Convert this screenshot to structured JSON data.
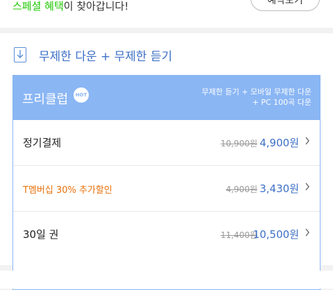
{
  "top": {
    "highlight": "스페셜 혜택",
    "message": "이 찾아갑니다!",
    "reserve_button": "예약보기"
  },
  "section": {
    "title": "무제한 다운 + 무제한 듣기"
  },
  "plan": {
    "name": "프리클럽",
    "badge": "HOT",
    "desc_line1": "무제한 듣기 + 모바일 무제한 다운",
    "desc_line2": "+ PC 100곡 다운",
    "options": [
      {
        "label": "정기결제",
        "original_price": "10,900원",
        "price": "4,900원"
      },
      {
        "label": "T멤버십 30% 추가할인",
        "original_price": "4,900원",
        "price": "3,430원"
      },
      {
        "label": "30일 권",
        "original_price": "11,400원",
        "price": "10,500원"
      }
    ]
  },
  "colors": {
    "accent": "#3d70c6",
    "header_bg": "#8ab6f4",
    "discount": "#e8700a",
    "highlight": "#1ec800"
  }
}
